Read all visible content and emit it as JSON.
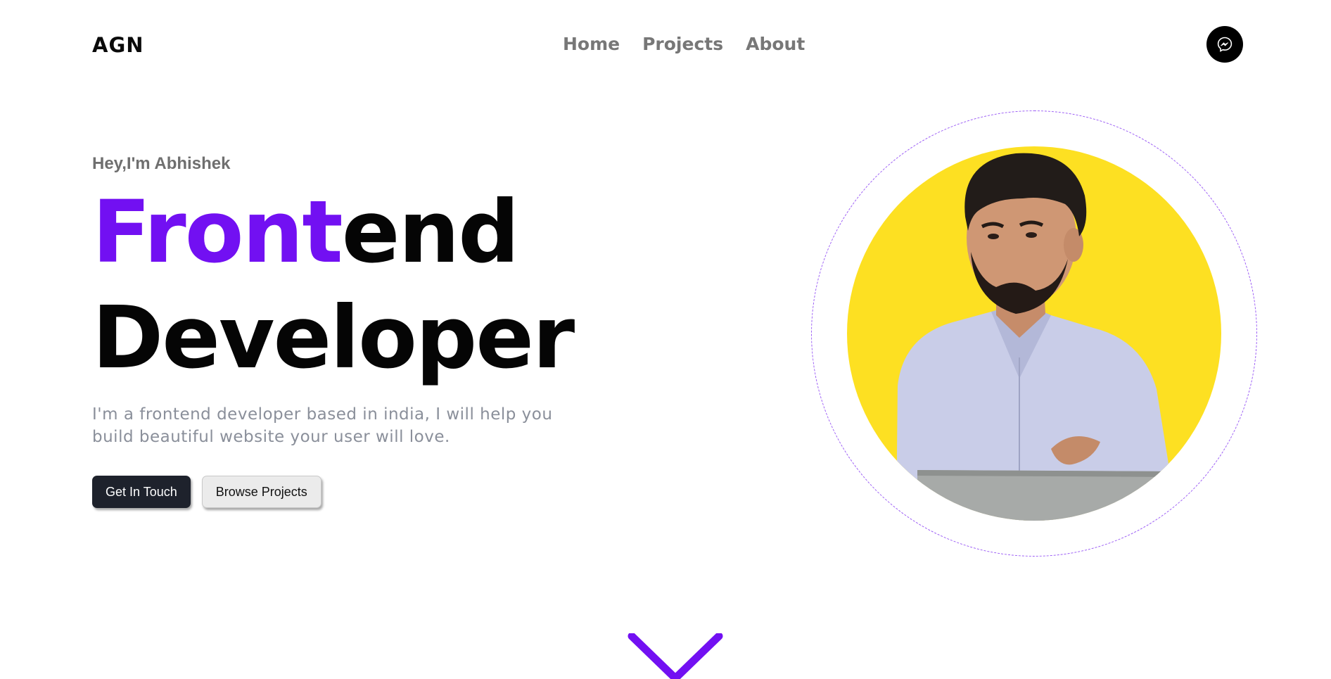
{
  "header": {
    "logo": "AGN",
    "nav": [
      {
        "label": "Home"
      },
      {
        "label": "Projects"
      },
      {
        "label": "About"
      }
    ],
    "social_icon": "messenger-icon"
  },
  "hero": {
    "greeting": "Hey,I'm Abhishek",
    "headline": {
      "accent": "Front",
      "rest_line1": "end",
      "line2": "Developer"
    },
    "description": "I'm a frontend developer based in india, I will help you build beautiful website your user will love.",
    "buttons": {
      "primary": "Get In Touch",
      "secondary": "Browse Projects"
    },
    "portrait_icon": "profile-photo",
    "scroll_icon": "chevron-down-icon"
  },
  "colors": {
    "accent": "#7210f2",
    "portrait_background": "#fde022",
    "primary_button": "#1e222c",
    "muted_text": "#8a8f9a"
  }
}
